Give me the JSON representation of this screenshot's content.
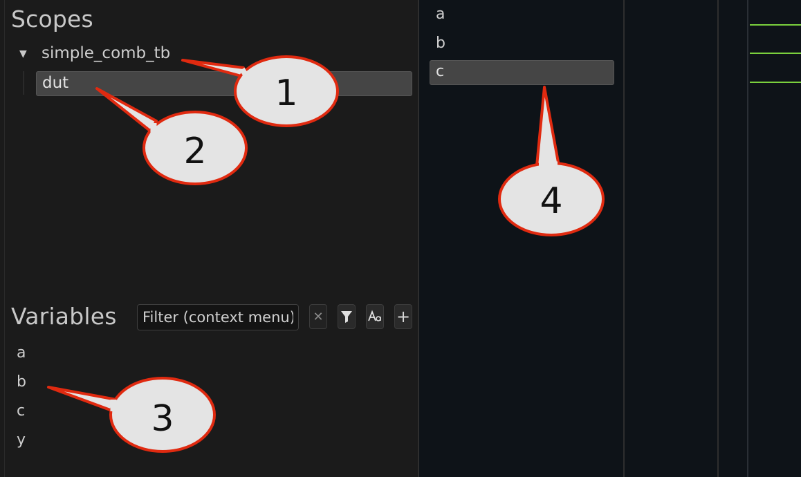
{
  "scopes": {
    "heading": "Scopes",
    "tree": {
      "expand_glyph": "▼",
      "root": "simple_comb_tb",
      "child": "dut"
    }
  },
  "variables": {
    "heading": "Variables",
    "filter_placeholder": "Filter (context menu)",
    "toolbar": {
      "clear_glyph": "✕",
      "add_glyph": "+"
    },
    "items": [
      "a",
      "b",
      "c",
      "y"
    ]
  },
  "signals": {
    "items": [
      "a",
      "b",
      "c"
    ],
    "selected_index": 2
  },
  "colors": {
    "waveform": "#7bd13d",
    "selection": "#454545",
    "callout_fill": "#e4e4e4",
    "callout_stroke": "#e02a10"
  },
  "callouts": [
    "1",
    "2",
    "3",
    "4"
  ]
}
